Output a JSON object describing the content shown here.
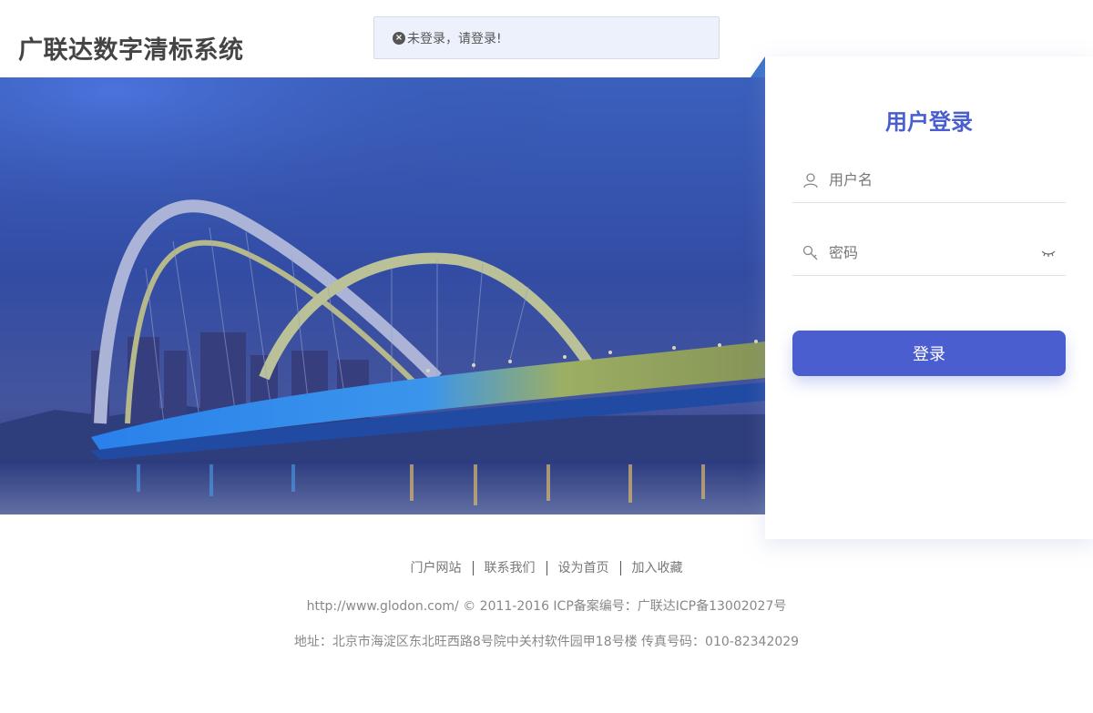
{
  "app": {
    "title": "广联达数字清标系统"
  },
  "toast": {
    "message": "未登录，请登录!",
    "icon": "error-circle-icon"
  },
  "login": {
    "title": "用户登录",
    "username_placeholder": "用户名",
    "password_placeholder": "密码",
    "submit_label": "登录",
    "accent_color": "#4a5ecf"
  },
  "footer": {
    "links": [
      "门户网站",
      "联系我们",
      "设为首页",
      "加入收藏"
    ],
    "copyright": "http://www.glodon.com/ © 2011-2016 ICP备案编号：广联达ICP备13002027号",
    "address": "地址：北京市海淀区东北旺西路8号院中关村软件园甲18号楼 传真号码：010-82342029"
  }
}
